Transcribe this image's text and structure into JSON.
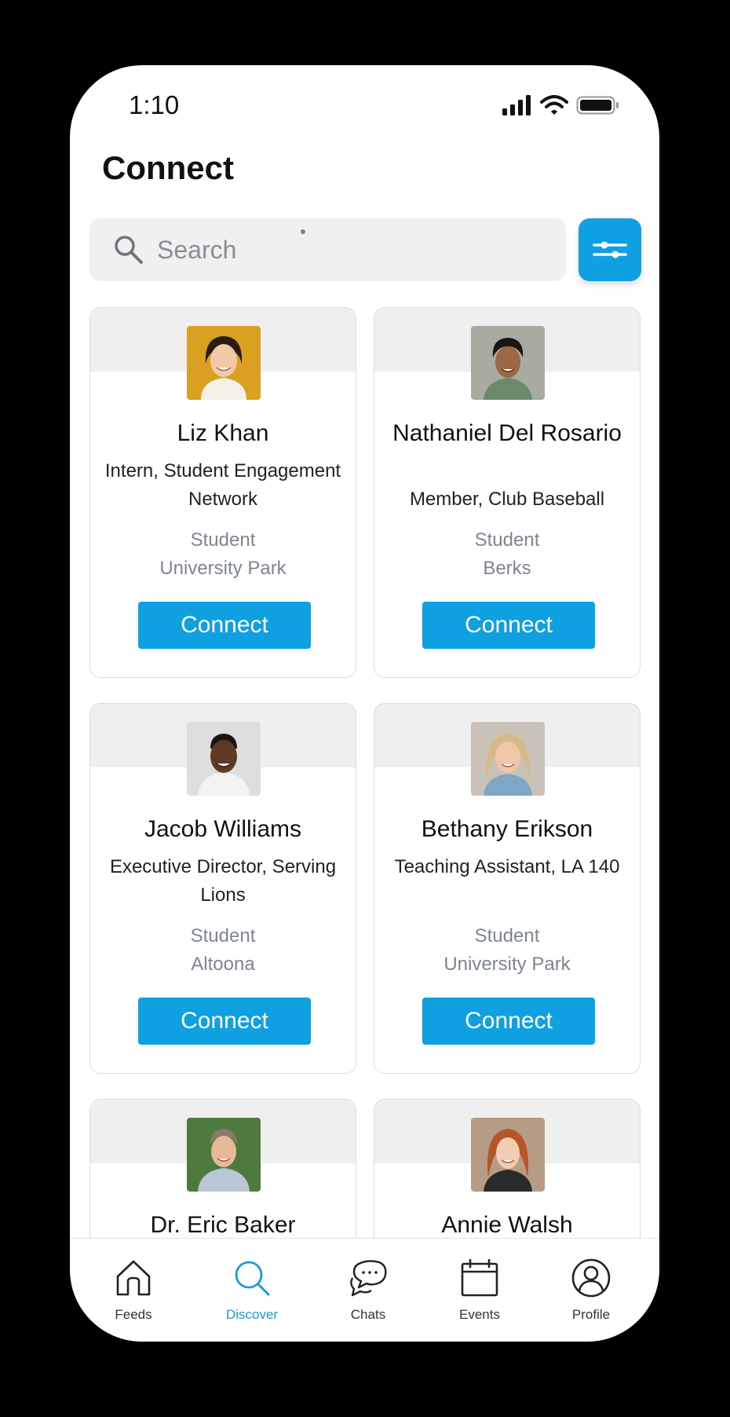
{
  "status_bar": {
    "time": "1:10"
  },
  "page_title": "Connect",
  "search": {
    "placeholder": "Search"
  },
  "people": [
    {
      "name": "Liz Khan",
      "role": "Intern, Student Engagement Network",
      "type": "Student",
      "campus": "University Park",
      "connect_label": "Connect"
    },
    {
      "name": "Nathaniel Del Rosario",
      "role": "Member, Club Baseball",
      "type": "Student",
      "campus": "Berks",
      "connect_label": "Connect"
    },
    {
      "name": "Jacob Williams",
      "role": "Executive Director, Serving Lions",
      "type": "Student",
      "campus": "Altoona",
      "connect_label": "Connect"
    },
    {
      "name": "Bethany Erikson",
      "role": "Teaching Assistant, LA 140",
      "type": "Student",
      "campus": "University Park",
      "connect_label": "Connect"
    },
    {
      "name": "Dr. Eric Baker",
      "role": "",
      "type": "",
      "campus": "",
      "connect_label": ""
    },
    {
      "name": "Annie Walsh",
      "role": "",
      "type": "",
      "campus": "",
      "connect_label": ""
    }
  ],
  "tabs": [
    {
      "label": "Feeds",
      "icon": "home-icon"
    },
    {
      "label": "Discover",
      "icon": "search-icon"
    },
    {
      "label": "Chats",
      "icon": "chat-bubbles-icon"
    },
    {
      "label": "Events",
      "icon": "calendar-icon"
    },
    {
      "label": "Profile",
      "icon": "user-icon"
    }
  ],
  "colors": {
    "accent": "#0ea0e0",
    "active_tab": "#1a9bd7",
    "muted_text": "#7d8590",
    "card_band": "#efefef"
  }
}
